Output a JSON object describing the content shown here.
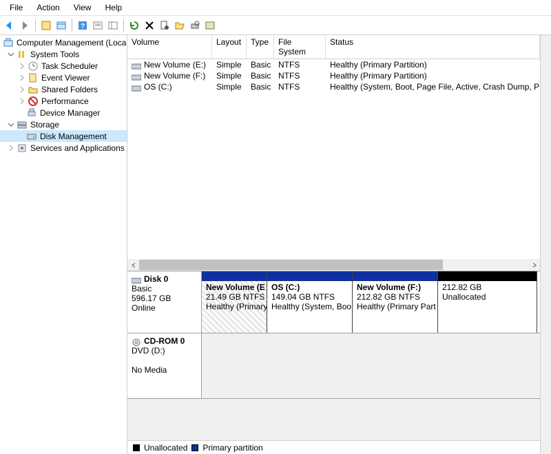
{
  "menu": {
    "file": "File",
    "action": "Action",
    "view": "View",
    "help": "Help"
  },
  "tree": {
    "root": "Computer Management (Local",
    "system_tools": "System Tools",
    "task_scheduler": "Task Scheduler",
    "event_viewer": "Event Viewer",
    "shared_folders": "Shared Folders",
    "performance": "Performance",
    "device_manager": "Device Manager",
    "storage": "Storage",
    "disk_management": "Disk Management",
    "services_apps": "Services and Applications"
  },
  "columns": {
    "volume": "Volume",
    "layout": "Layout",
    "type": "Type",
    "filesystem": "File System",
    "status": "Status"
  },
  "volumes": [
    {
      "name": "New Volume (E:)",
      "layout": "Simple",
      "type": "Basic",
      "fs": "NTFS",
      "status": "Healthy (Primary Partition)"
    },
    {
      "name": "New Volume (F:)",
      "layout": "Simple",
      "type": "Basic",
      "fs": "NTFS",
      "status": "Healthy (Primary Partition)"
    },
    {
      "name": "OS (C:)",
      "layout": "Simple",
      "type": "Basic",
      "fs": "NTFS",
      "status": "Healthy (System, Boot, Page File, Active, Crash Dump, Prima"
    }
  ],
  "disk0": {
    "name": "Disk 0",
    "type": "Basic",
    "size": "596.17 GB",
    "state": "Online",
    "parts": [
      {
        "name": "New Volume  (E",
        "info": "21.49 GB NTFS",
        "status": "Healthy (Primary",
        "color": "#1030a0",
        "hatched": true,
        "w": 95
      },
      {
        "name": "OS  (C:)",
        "info": "149.04 GB NTFS",
        "status": "Healthy (System, Boo",
        "color": "#1030a0",
        "hatched": false,
        "w": 124
      },
      {
        "name": "New Volume  (F:)",
        "info": "212.82 GB NTFS",
        "status": "Healthy (Primary Part",
        "color": "#1030a0",
        "hatched": false,
        "w": 124
      },
      {
        "name": "",
        "info": "212.82 GB",
        "status": "Unallocated",
        "color": "#000000",
        "hatched": false,
        "w": 144
      }
    ]
  },
  "cdrom": {
    "name": "CD-ROM 0",
    "type": "DVD (D:)",
    "state": "No Media"
  },
  "legend": {
    "unallocated": "Unallocated",
    "primary": "Primary partition"
  }
}
